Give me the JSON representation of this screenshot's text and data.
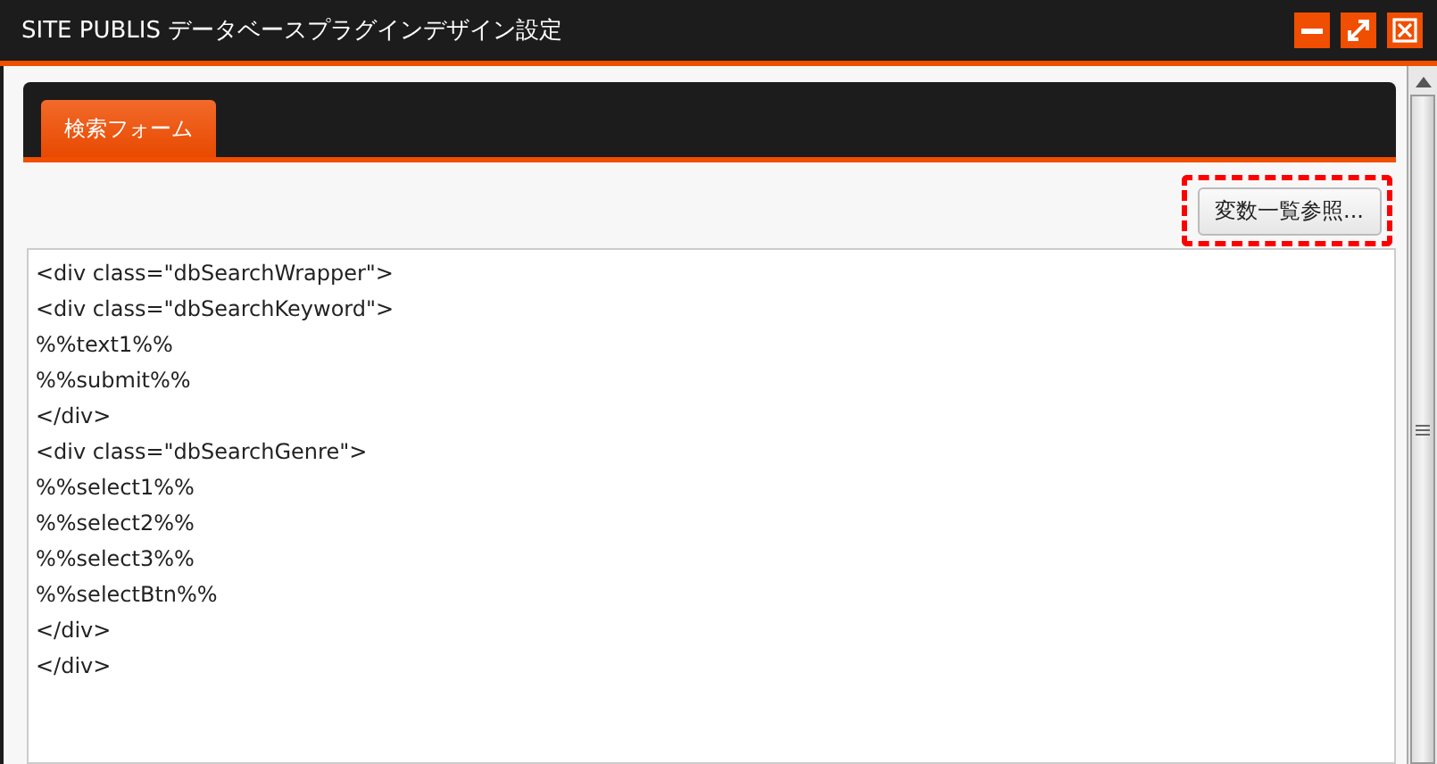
{
  "window": {
    "title": "SITE PUBLIS データベースプラグインデザイン設定"
  },
  "tabs": [
    {
      "label": "検索フォーム",
      "selected": true
    }
  ],
  "variables_button": {
    "label": "変数一覧参照...",
    "highlighted": true
  },
  "code_lines": [
    "<div class=\"dbSearchWrapper\">",
    "<div class=\"dbSearchKeyword\">",
    "%%text1%%",
    "%%submit%%",
    "</div>",
    "<div class=\"dbSearchGenre\">",
    "%%select1%%",
    "%%select2%%",
    "%%select3%%",
    "%%selectBtn%%",
    "</div>",
    "</div>"
  ]
}
